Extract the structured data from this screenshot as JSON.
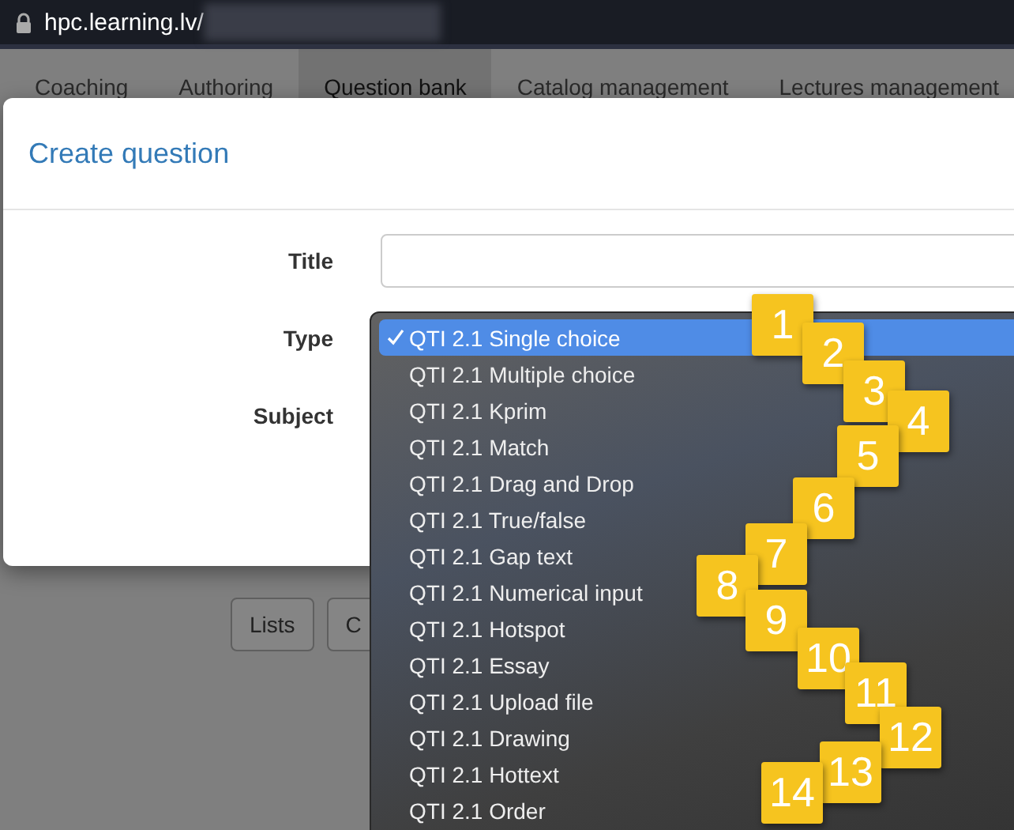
{
  "address_bar": {
    "url": "hpc.learning.lv/"
  },
  "nav_tabs": [
    {
      "label": "Coaching",
      "selected": false
    },
    {
      "label": "Authoring",
      "selected": false
    },
    {
      "label": "Question bank",
      "selected": true
    },
    {
      "label": "Catalog management",
      "selected": false
    },
    {
      "label": "Lectures management",
      "selected": false
    }
  ],
  "page_buttons": [
    "Lists",
    "C"
  ],
  "dialog": {
    "title": "Create question",
    "fields": [
      {
        "label": "Title",
        "kind": "input"
      },
      {
        "label": "Type",
        "kind": "covered"
      },
      {
        "label": "Subject",
        "kind": "covered"
      }
    ]
  },
  "type_dropdown": [
    {
      "label": "QTI 2.1 Single choice",
      "selected": true
    },
    {
      "label": "QTI 2.1 Multiple choice",
      "selected": false
    },
    {
      "label": "QTI 2.1 Kprim",
      "selected": false
    },
    {
      "label": "QTI 2.1 Match",
      "selected": false
    },
    {
      "label": "QTI 2.1 Drag and Drop",
      "selected": false
    },
    {
      "label": "QTI 2.1 True/false",
      "selected": false
    },
    {
      "label": "QTI 2.1 Gap text",
      "selected": false
    },
    {
      "label": "QTI 2.1 Numerical input",
      "selected": false
    },
    {
      "label": "QTI 2.1 Hotspot",
      "selected": false
    },
    {
      "label": "QTI 2.1 Essay",
      "selected": false
    },
    {
      "label": "QTI 2.1 Upload file",
      "selected": false
    },
    {
      "label": "QTI 2.1 Drawing",
      "selected": false
    },
    {
      "label": "QTI 2.1 Hottext",
      "selected": false
    },
    {
      "label": "QTI 2.1 Order",
      "selected": false
    }
  ],
  "badges": [
    "1",
    "2",
    "3",
    "4",
    "5",
    "6",
    "7",
    "8",
    "9",
    "10",
    "11",
    "12",
    "13",
    "14"
  ]
}
